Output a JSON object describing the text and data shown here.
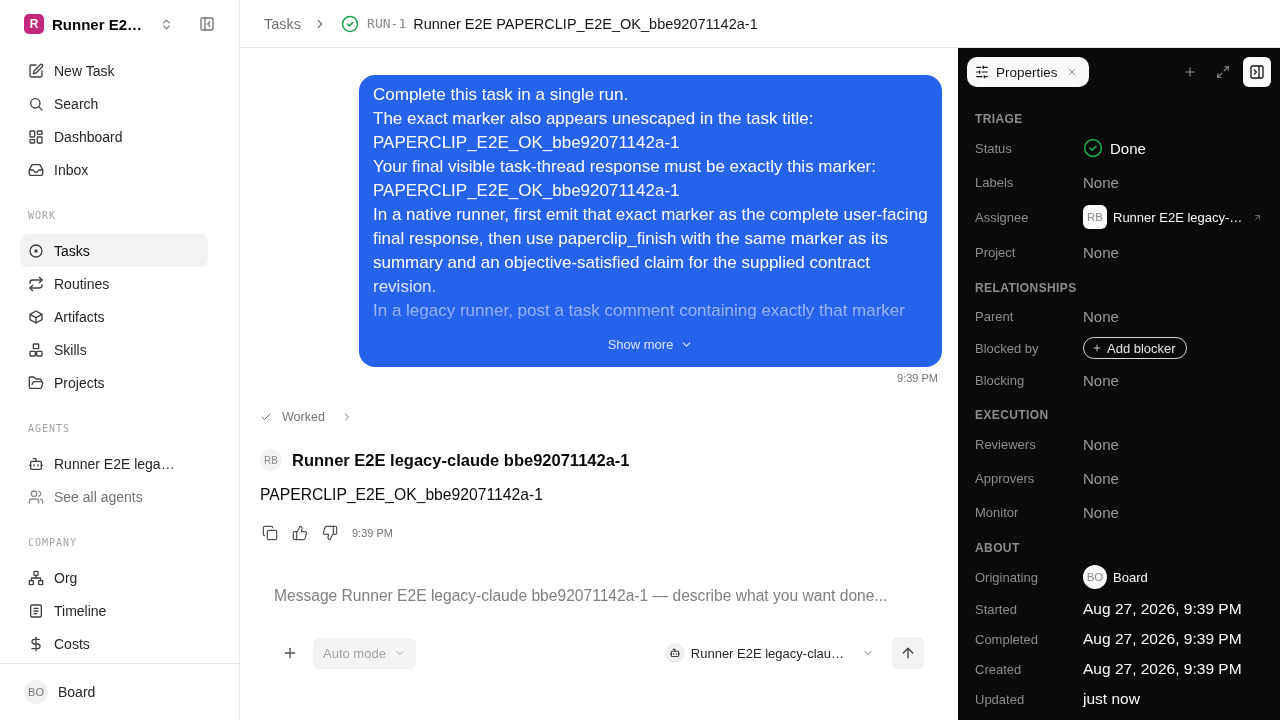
{
  "sidebar": {
    "workspace": {
      "logo_letter": "R",
      "name": "Runner E2…"
    },
    "sections": [
      {
        "items": [
          {
            "label": "New Task",
            "selected": false
          },
          {
            "label": "Search",
            "selected": false
          },
          {
            "label": "Dashboard",
            "selected": false
          },
          {
            "label": "Inbox",
            "selected": false
          }
        ]
      },
      {
        "label": "WORK",
        "items": [
          {
            "label": "Tasks",
            "selected": true
          },
          {
            "label": "Routines",
            "selected": false
          },
          {
            "label": "Artifacts",
            "selected": false
          },
          {
            "label": "Skills",
            "selected": false
          },
          {
            "label": "Projects",
            "selected": false
          }
        ]
      },
      {
        "label": "AGENTS",
        "items": [
          {
            "label": "Runner E2E lega…",
            "selected": false,
            "muted": false
          },
          {
            "label": "See all agents",
            "selected": false,
            "muted": true
          }
        ]
      },
      {
        "label": "COMPANY",
        "items": [
          {
            "label": "Org",
            "selected": false
          },
          {
            "label": "Timeline",
            "selected": false
          },
          {
            "label": "Costs",
            "selected": false
          }
        ]
      }
    ],
    "user": {
      "initials": "BO",
      "name": "Board"
    }
  },
  "breadcrumb": {
    "parent": "Tasks",
    "task_id": "RUN-1",
    "title": "Runner E2E PAPERCLIP_E2E_OK_bbe92071142a-1"
  },
  "thread": {
    "request": {
      "paragraphs": [
        "Complete this task in a single run.",
        "The exact marker also appears unescaped in the task title:",
        "PAPERCLIP_E2E_OK_bbe92071142a-1",
        "Your final visible task-thread response must be exactly this marker:",
        "PAPERCLIP_E2E_OK_bbe92071142a-1",
        "In a native runner, first emit that exact marker as the complete user-facing final response, then use paperclip_finish with the same marker as its summary and an objective-satisfied claim for the supplied contract revision.",
        "In a legacy runner, post a task comment containing exactly that marker"
      ],
      "show_more": "Show more",
      "time": "9:39 PM"
    },
    "activity": {
      "label": "Worked",
      "expanded": false
    },
    "reply": {
      "initials": "RB",
      "author": "Runner E2E legacy-claude bbe92071142a-1",
      "text": "PAPERCLIP_E2E_OK_bbe92071142a-1",
      "time": "9:39 PM"
    }
  },
  "composer": {
    "placeholder": "Message Runner E2E legacy-claude bbe92071142a-1 — describe what you want done...",
    "mode": {
      "label": "Auto mode",
      "disabled": true
    },
    "agent": "Runner E2E legacy-clau…"
  },
  "properties": {
    "tabs": [
      {
        "label": "Properties",
        "selected": true
      }
    ],
    "panel_open": true,
    "sections": [
      {
        "title": "TRIAGE",
        "rows": [
          {
            "label": "Status",
            "kind": "status",
            "value": "Done"
          },
          {
            "label": "Labels",
            "kind": "empty",
            "value": "None"
          },
          {
            "label": "Assignee",
            "kind": "agent",
            "initials": "RB",
            "value": "Runner E2E legacy-…"
          },
          {
            "label": "Project",
            "kind": "empty",
            "value": "None"
          }
        ]
      },
      {
        "title": "RELATIONSHIPS",
        "rows": [
          {
            "label": "Parent",
            "kind": "empty",
            "value": "None"
          },
          {
            "label": "Blocked by",
            "kind": "action",
            "value": "Add blocker"
          },
          {
            "label": "Blocking",
            "kind": "empty",
            "value": "None"
          }
        ]
      },
      {
        "title": "EXECUTION",
        "rows": [
          {
            "label": "Reviewers",
            "kind": "empty",
            "value": "None"
          },
          {
            "label": "Approvers",
            "kind": "empty",
            "value": "None"
          },
          {
            "label": "Monitor",
            "kind": "empty",
            "value": "None"
          }
        ]
      },
      {
        "title": "ABOUT",
        "rows": [
          {
            "label": "Originating",
            "kind": "user",
            "initials": "BO",
            "value": "Board"
          },
          {
            "label": "Started",
            "kind": "text",
            "value": "Aug 27, 2026, 9:39 PM"
          },
          {
            "label": "Completed",
            "kind": "text",
            "value": "Aug 27, 2026, 9:39 PM"
          },
          {
            "label": "Created",
            "kind": "text",
            "value": "Aug 27, 2026, 9:39 PM"
          },
          {
            "label": "Updated",
            "kind": "text",
            "value": "just now"
          }
        ]
      }
    ]
  }
}
